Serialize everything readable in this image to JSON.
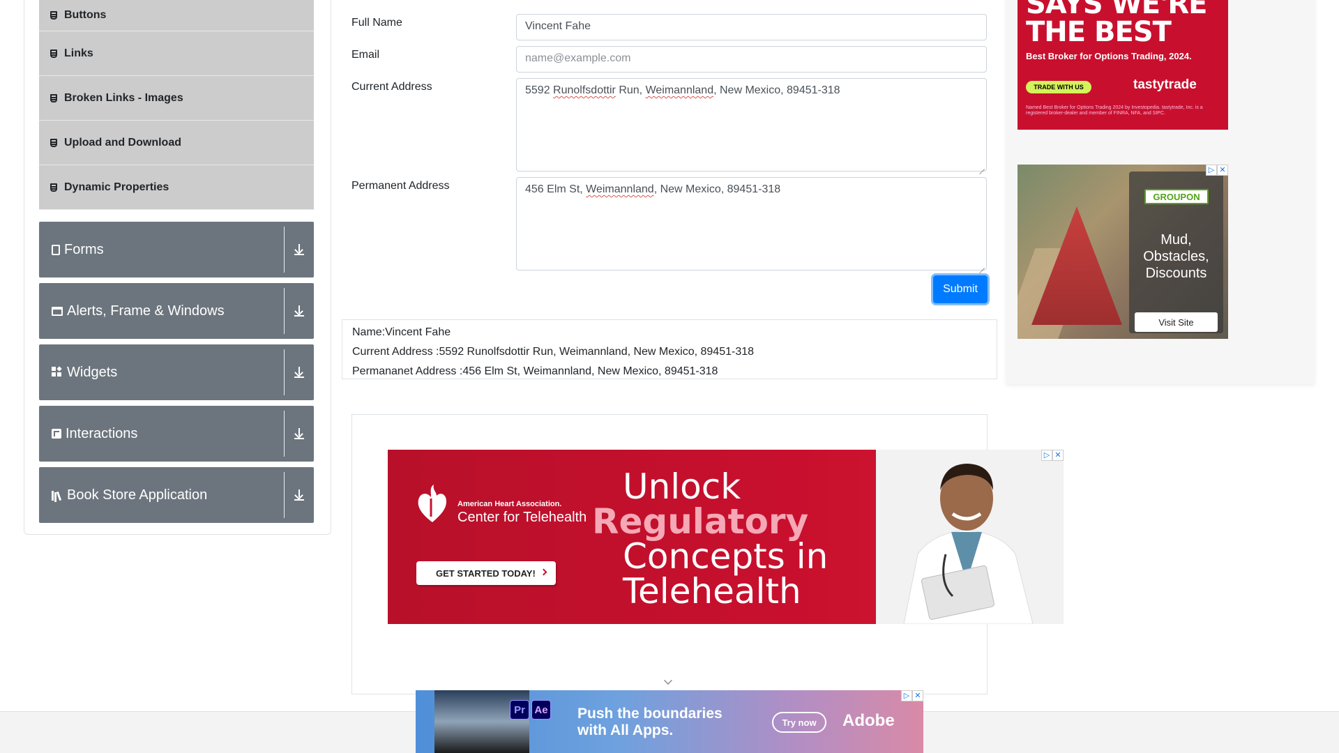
{
  "sidebar": {
    "sub_items": [
      {
        "label": "Buttons"
      },
      {
        "label": "Links"
      },
      {
        "label": "Broken Links - Images"
      },
      {
        "label": "Upload and Download"
      },
      {
        "label": "Dynamic Properties"
      }
    ],
    "groups": [
      {
        "label": "Forms",
        "icon": "forms-icon"
      },
      {
        "label": "Alerts, Frame & Windows",
        "icon": "window-icon"
      },
      {
        "label": "Widgets",
        "icon": "widgets-icon"
      },
      {
        "label": "Interactions",
        "icon": "interactions-icon"
      },
      {
        "label": "Book Store Application",
        "icon": "book-icon"
      }
    ]
  },
  "form": {
    "full_name_label": "Full Name",
    "full_name_value": "Vincent Fahe",
    "email_label": "Email",
    "email_placeholder": "name@example.com",
    "current_address_label": "Current Address",
    "current_address_value": "5592 Runolfsdottir Run, Weimannland, New Mexico, 89451-318",
    "permanent_address_label": "Permanent Address",
    "permanent_address_value": "456 Elm St, Weimannland, New Mexico, 89451-318",
    "submit_label": "Submit"
  },
  "output": {
    "name": "Name:Vincent Fahe",
    "current_address": "Current Address :5592 Runolfsdottir Run, Weimannland, New Mexico, 89451-318",
    "permanent_address": "Permananet Address :456 Elm St, Weimannland, New Mexico, 89451-318"
  },
  "ads": {
    "tastytrade": {
      "headline": "SAYS WE'RE THE BEST",
      "sub": "Best Broker for Options Trading, 2024.",
      "cta": "TRADE WITH US",
      "brand": "tastytrade",
      "fine": "Named Best Broker for Options Trading 2024 by Investopedia. tastytrade, Inc. is a registered broker-dealer and member of FINRA, NFA, and SIPC."
    },
    "groupon": {
      "brand": "GROUPON",
      "text": "Mud, Obstacles, Discounts",
      "cta": "Visit Site"
    },
    "heart": {
      "org_line1": "American Heart Association.",
      "org_line2": "Center for Telehealth",
      "cta": "GET STARTED TODAY!",
      "headline_1": "Unlock",
      "headline_2": "Regulatory",
      "headline_3": "Concepts in",
      "headline_4": "Telehealth"
    },
    "adobe": {
      "pr": "Pr",
      "ae": "Ae",
      "line1": "Push the boundaries",
      "line2": "with All Apps.",
      "cta": "Try now",
      "brand": "Adobe"
    }
  },
  "colors": {
    "sidebar_group_bg": "#6c757d",
    "sidebar_sub_bg": "#cccccc",
    "submit_bg": "#007bff",
    "ad_red": "#c8102e"
  }
}
